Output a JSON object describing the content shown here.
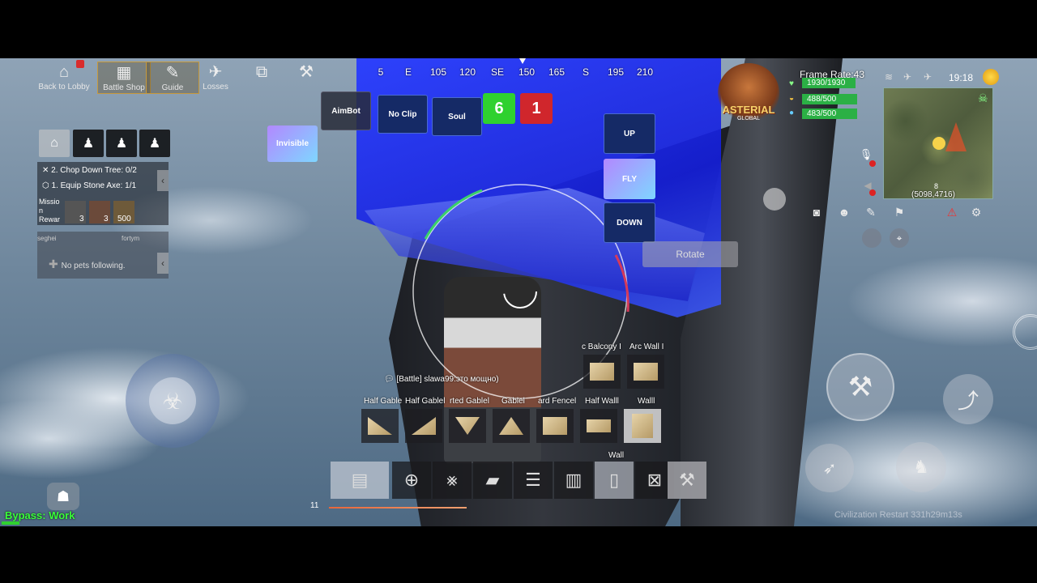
{
  "top_nav": {
    "items": [
      {
        "label": "Back to Lobby",
        "icon": "home-icon",
        "glyph": "⌂"
      },
      {
        "label": "Battle Shop",
        "icon": "shop-icon",
        "glyph": "▦"
      },
      {
        "label": "Guide",
        "icon": "book-icon",
        "glyph": "✎"
      },
      {
        "label": "Losses",
        "icon": "losses-icon",
        "glyph": "✈"
      },
      {
        "label": "",
        "icon": "map-book-icon",
        "glyph": "⧉"
      },
      {
        "label": "",
        "icon": "tool-icon",
        "glyph": "⚒"
      }
    ]
  },
  "compass": {
    "ticks": [
      "5",
      "E",
      "105",
      "120",
      "SE",
      "150",
      "165",
      "S",
      "195",
      "210"
    ]
  },
  "cheats": {
    "aimbot": "AimBot",
    "noclip": "No Clip",
    "soul": "Soul",
    "invisible": "Invisible",
    "up": "UP",
    "fly": "FLY",
    "down": "DOWN",
    "rotate": "Rotate",
    "count_green": "6",
    "count_red": "1"
  },
  "quests": {
    "q1": "2. Chop Down Tree: 0/2",
    "q2": "1. Equip Stone Axe: 1/1",
    "mission_label": "Missio n Rewar",
    "reward_counts": [
      "3",
      "3",
      "500"
    ],
    "pets_text": "No pets following.",
    "player_names": [
      "seghei",
      "fortym"
    ]
  },
  "brand": {
    "name": "ASTERIAL",
    "sub": "GLOBAL"
  },
  "stats": {
    "frame_rate": "Frame Rate:43",
    "health": "1930/1930",
    "food": "488/500",
    "water": "483/500",
    "time": "19:18",
    "coords": "(5098,4716)",
    "map_marker": "8"
  },
  "chat": {
    "message": "[Battle] slawa99:это мощно)"
  },
  "build": {
    "row1_labels": [
      "c Balcony I",
      "Arc Wall I"
    ],
    "row2_labels": [
      "Half Gable",
      "Half Gablel",
      "rted Gablel",
      "Gablel",
      "ard Fencel",
      "Half Walll",
      "Walll"
    ],
    "hotbar_label": "Wall",
    "hotbar_count": "11"
  },
  "footer": {
    "bypass": "Bypass: Work",
    "restart": "Civilization Restart 331h29m13s"
  },
  "colors": {
    "accent_blue": "#1f2bd8",
    "green_count": "#2fd12f",
    "red_count": "#d0262c",
    "bypass_green": "#3aff3a"
  }
}
